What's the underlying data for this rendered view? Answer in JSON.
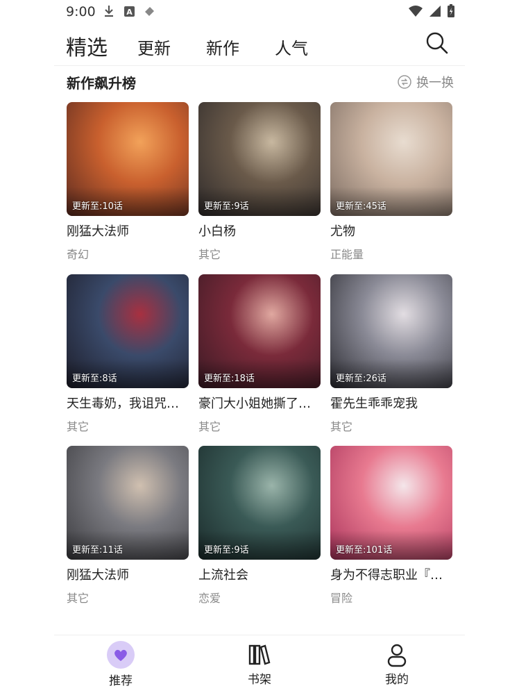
{
  "status_bar": {
    "time": "9:00",
    "icons": [
      "download-icon",
      "text-a-icon",
      "tag-icon",
      "wifi-icon",
      "signal-icon",
      "battery-icon"
    ]
  },
  "tabs": [
    {
      "label": "精选",
      "active": true
    },
    {
      "label": "更新",
      "active": false
    },
    {
      "label": "新作",
      "active": false
    },
    {
      "label": "人气",
      "active": false
    }
  ],
  "section": {
    "title": "新作飙升榜",
    "refresh_label": "换一换"
  },
  "comics": [
    {
      "title": "刚猛大法师",
      "genre": "奇幻",
      "badge": "更新至:10话",
      "colors": [
        "#5a2a20",
        "#c9602e",
        "#f2a25a"
      ]
    },
    {
      "title": "小白杨",
      "genre": "其它",
      "badge": "更新至:9话",
      "colors": [
        "#2e2a2a",
        "#6a5a4a",
        "#c8b8a0"
      ]
    },
    {
      "title": "尤物",
      "genre": "正能量",
      "badge": "更新至:45话",
      "colors": [
        "#7a6a60",
        "#c9b2a0",
        "#e8dcd0"
      ]
    },
    {
      "title": "天生毒奶，我诅咒了...",
      "genre": "其它",
      "badge": "更新至:8话",
      "colors": [
        "#1c1c28",
        "#3a4a6a",
        "#a83040"
      ]
    },
    {
      "title": "豪门大小姐她撕了白...",
      "genre": "其它",
      "badge": "更新至:18话",
      "colors": [
        "#3a1a24",
        "#7a2a3a",
        "#e0a8a0"
      ]
    },
    {
      "title": "霍先生乖乖宠我",
      "genre": "其它",
      "badge": "更新至:26话",
      "colors": [
        "#2a2a30",
        "#8a8a96",
        "#e2dde2"
      ]
    },
    {
      "title": "刚猛大法师",
      "genre": "其它",
      "badge": "更新至:11话",
      "colors": [
        "#3a3a3e",
        "#7a7a80",
        "#d0c0b0"
      ]
    },
    {
      "title": "上流社会",
      "genre": "恋爱",
      "badge": "更新至:9话",
      "colors": [
        "#1a2a2a",
        "#3a5a56",
        "#9ab4aa"
      ]
    },
    {
      "title": "身为不得志职业『锻...",
      "genre": "冒险",
      "badge": "更新至:101话",
      "colors": [
        "#a8325a",
        "#e87a90",
        "#f4e6ea"
      ]
    }
  ],
  "bottom_nav": [
    {
      "label": "推荐",
      "icon": "heart-icon",
      "active": true
    },
    {
      "label": "书架",
      "icon": "bookshelf-icon",
      "active": false
    },
    {
      "label": "我的",
      "icon": "person-icon",
      "active": false
    }
  ],
  "accent_color": "#b9a2f0"
}
